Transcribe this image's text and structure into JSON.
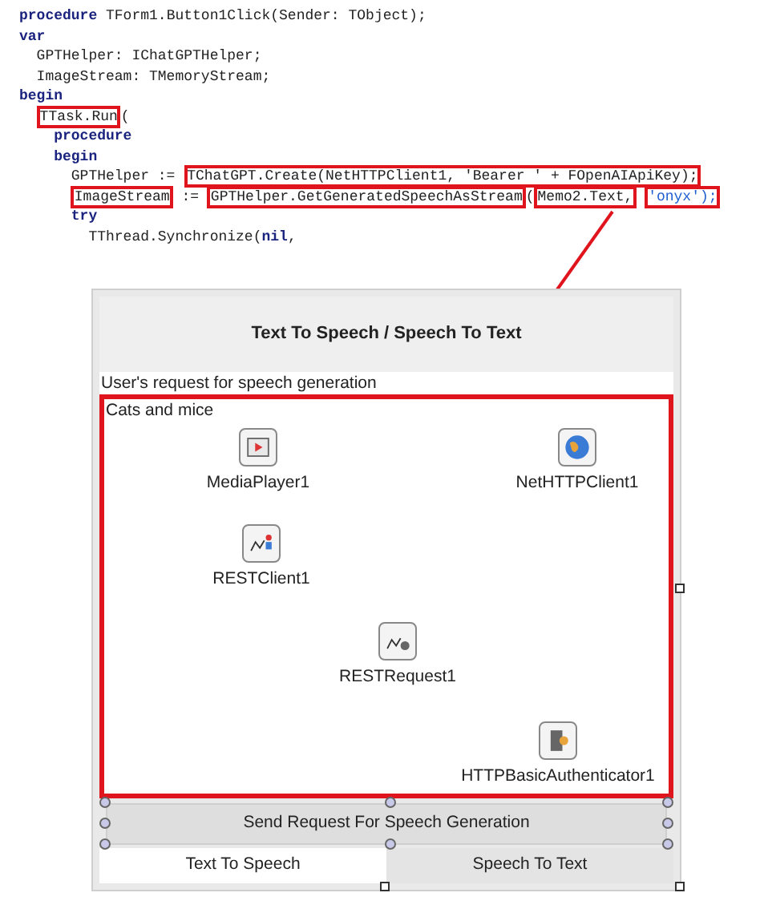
{
  "code": {
    "lines": [
      [
        {
          "text": "procedure",
          "kind": "keyword",
          "highlighted": false
        },
        {
          "text": " TForm1.Button1Click(Sender: TObject);",
          "kind": "plain",
          "highlighted": false
        }
      ],
      [
        {
          "text": "var",
          "kind": "keyword",
          "highlighted": false
        }
      ],
      [
        {
          "text": "GPTHelper: IChatGPTHelper;",
          "kind": "plain",
          "highlighted": false
        }
      ],
      [
        {
          "text": "ImageStream: TMemoryStream;",
          "kind": "plain",
          "highlighted": false
        }
      ],
      [
        {
          "text": "begin",
          "kind": "keyword",
          "highlighted": false
        }
      ],
      [
        {
          "text": "TTask.Run",
          "kind": "plain",
          "highlighted": true
        },
        {
          "text": "(",
          "kind": "plain",
          "highlighted": false
        }
      ],
      [
        {
          "text": "procedure",
          "kind": "keyword",
          "highlighted": false
        }
      ],
      [
        {
          "text": "begin",
          "kind": "keyword",
          "highlighted": false
        }
      ],
      [
        {
          "text": "GPTHelper := ",
          "kind": "plain",
          "highlighted": false
        },
        {
          "text": "TChatGPT.Create(NetHTTPClient1, 'Bearer ' + FOpenAIApiKey);",
          "kind": "plain",
          "highlighted": true
        }
      ],
      [
        {
          "text": "ImageStream",
          "kind": "plain",
          "highlighted": true
        },
        {
          "text": " := ",
          "kind": "plain",
          "highlighted": false
        },
        {
          "text": "GPTHelper.GetGeneratedSpeechAsStream",
          "kind": "plain",
          "highlighted": true
        },
        {
          "text": "(",
          "kind": "plain",
          "highlighted": false
        },
        {
          "text": "Memo2.Text,",
          "kind": "plain",
          "highlighted": true
        },
        {
          "text": "'onyx');",
          "kind": "string",
          "highlighted": true
        }
      ],
      [
        {
          "text": "try",
          "kind": "keyword",
          "highlighted": false
        }
      ],
      [
        {
          "text": "TThread.Synchronize(",
          "kind": "plain",
          "highlighted": false
        },
        {
          "text": "nil",
          "kind": "keyword",
          "highlighted": false
        },
        {
          "text": ",",
          "kind": "plain",
          "highlighted": false
        }
      ]
    ]
  },
  "form": {
    "title": "Text To Speech / Speech To Text",
    "request_edit": {
      "value": "User's request for speech generation"
    },
    "memo": {
      "value": "Cats and mice",
      "highlighted": true
    },
    "components": [
      {
        "kind": "media",
        "name": "MediaPlayer1"
      },
      {
        "kind": "net",
        "name": "NetHTTPClient1"
      },
      {
        "kind": "rest-client",
        "name": "RESTClient1"
      },
      {
        "kind": "rest-request",
        "name": "RESTRequest1"
      },
      {
        "kind": "auth",
        "name": "HTTPBasicAuthenticator1"
      }
    ],
    "send_button": {
      "label": "Send Request For Speech Generation"
    },
    "tabs": [
      {
        "label": "Text To Speech",
        "selected": true
      },
      {
        "label": "Speech To Text",
        "selected": false
      }
    ]
  }
}
